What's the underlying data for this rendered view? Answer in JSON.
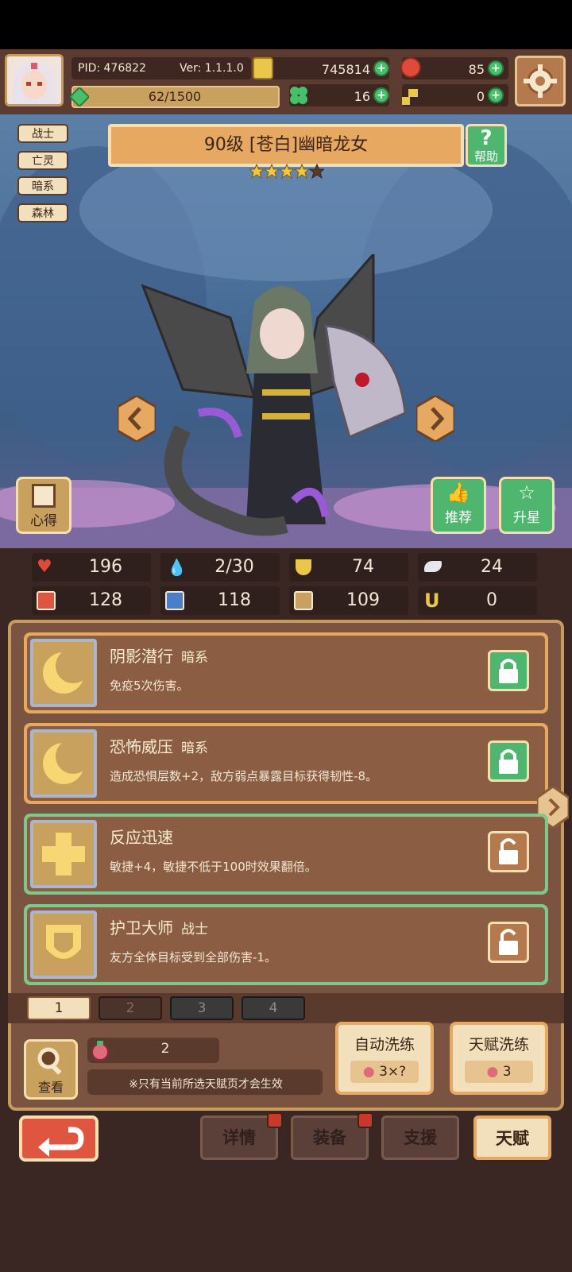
{
  "header": {
    "pid": "PID: 476822",
    "version": "Ver: 1.1.1.0",
    "exp": "62/1500",
    "gold": "745814",
    "gems": "85",
    "clover": "16",
    "keys": "0"
  },
  "hero": {
    "tags": [
      "战士",
      "亡灵",
      "暗系",
      "森林"
    ],
    "title": "90级 [苍白]幽暗龙女",
    "stars_filled": 4,
    "stars_total": 5,
    "help_label": "帮助",
    "insight_label": "心得",
    "recommend_label": "推荐",
    "upstar_label": "升星"
  },
  "stats": [
    {
      "icon": "heart-icon",
      "value": "196"
    },
    {
      "icon": "water-drop-icon",
      "value": "2/30"
    },
    {
      "icon": "shield-icon",
      "value": "74"
    },
    {
      "icon": "wing-icon",
      "value": "24"
    },
    {
      "icon": "fist-icon",
      "value": "128"
    },
    {
      "icon": "book-icon",
      "value": "118"
    },
    {
      "icon": "boot-icon",
      "value": "109"
    },
    {
      "icon": "horseshoe-icon",
      "value": "0"
    }
  ],
  "talents": [
    {
      "name": "阴影潜行",
      "type": "暗系",
      "desc": "免疫5次伤害。",
      "locked": true,
      "icon": "crescent-moon-icon"
    },
    {
      "name": "恐怖威压",
      "type": "暗系",
      "desc": "造成恐惧层数+2，敌方弱点暴露目标获得韧性-8。",
      "locked": true,
      "icon": "crescent-moon-icon"
    },
    {
      "name": "反应迅速",
      "type": "",
      "desc": "敏捷+4，敏捷不低于100时效果翻倍。",
      "locked": false,
      "icon": "cross-icon"
    },
    {
      "name": "护卫大师",
      "type": "战士",
      "desc": "友方全体目标受到全部伤害-1。",
      "locked": false,
      "icon": "shield-emblem-icon"
    }
  ],
  "pages": [
    "1",
    "2",
    "3",
    "4"
  ],
  "footer": {
    "view_label": "查看",
    "potion_count": "2",
    "notice": "※只有当前所选天赋页才会生效",
    "auto_refine_label": "自动洗练",
    "auto_refine_cost": "3×?",
    "talent_refine_label": "天赋洗练",
    "talent_refine_cost": "3"
  },
  "nav": {
    "details": "详情",
    "equipment": "装备",
    "support": "支援",
    "talent": "天赋"
  },
  "colors": {
    "accent_orange": "#e7a862",
    "green": "#4fb670",
    "red_button": "#e0553f",
    "panel_brown": "#7a5440"
  }
}
